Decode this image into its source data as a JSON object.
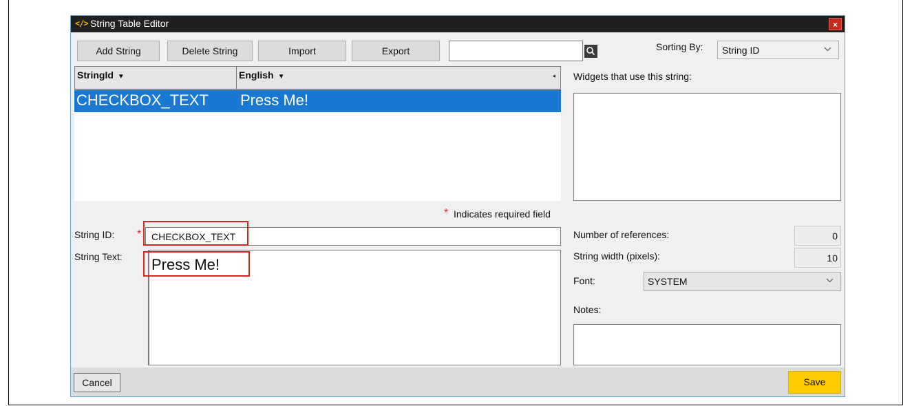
{
  "window": {
    "icon": "</>",
    "title": "String Table Editor",
    "close_glyph": "×"
  },
  "toolbar": {
    "add_string": "Add String",
    "delete_string": "Delete String",
    "import": "Import",
    "export": "Export",
    "search_value": "",
    "search_icon": "search-icon",
    "sorting_label": "Sorting By:",
    "sorting_value": "String ID"
  },
  "grid": {
    "columns": [
      {
        "label": "StringId",
        "sort_glyph": "▼"
      },
      {
        "label": "English",
        "sort_glyph": "▼"
      }
    ],
    "scroll_glyph": "◂",
    "rows": [
      {
        "string_id": "CHECKBOX_TEXT",
        "english": "Press Me!",
        "selected": true
      }
    ]
  },
  "form": {
    "required_star": "*",
    "required_note": "Indicates required field",
    "string_id_label": "String ID:",
    "string_id_value": "CHECKBOX_TEXT",
    "string_text_label": "String Text:",
    "string_text_value": "Press Me!"
  },
  "side": {
    "widgets_label": "Widgets that use this string:",
    "num_refs_label": "Number of references:",
    "num_refs_value": "0",
    "width_label": "String width (pixels):",
    "width_value": "10",
    "font_label": "Font:",
    "font_value": "SYSTEM",
    "notes_label": "Notes:",
    "notes_value": ""
  },
  "footer": {
    "cancel": "Cancel",
    "save": "Save"
  },
  "colors": {
    "selection": "#1a78d2",
    "save_button": "#ffcc00",
    "highlight_box": "#d92424",
    "titlebar": "#202020"
  }
}
